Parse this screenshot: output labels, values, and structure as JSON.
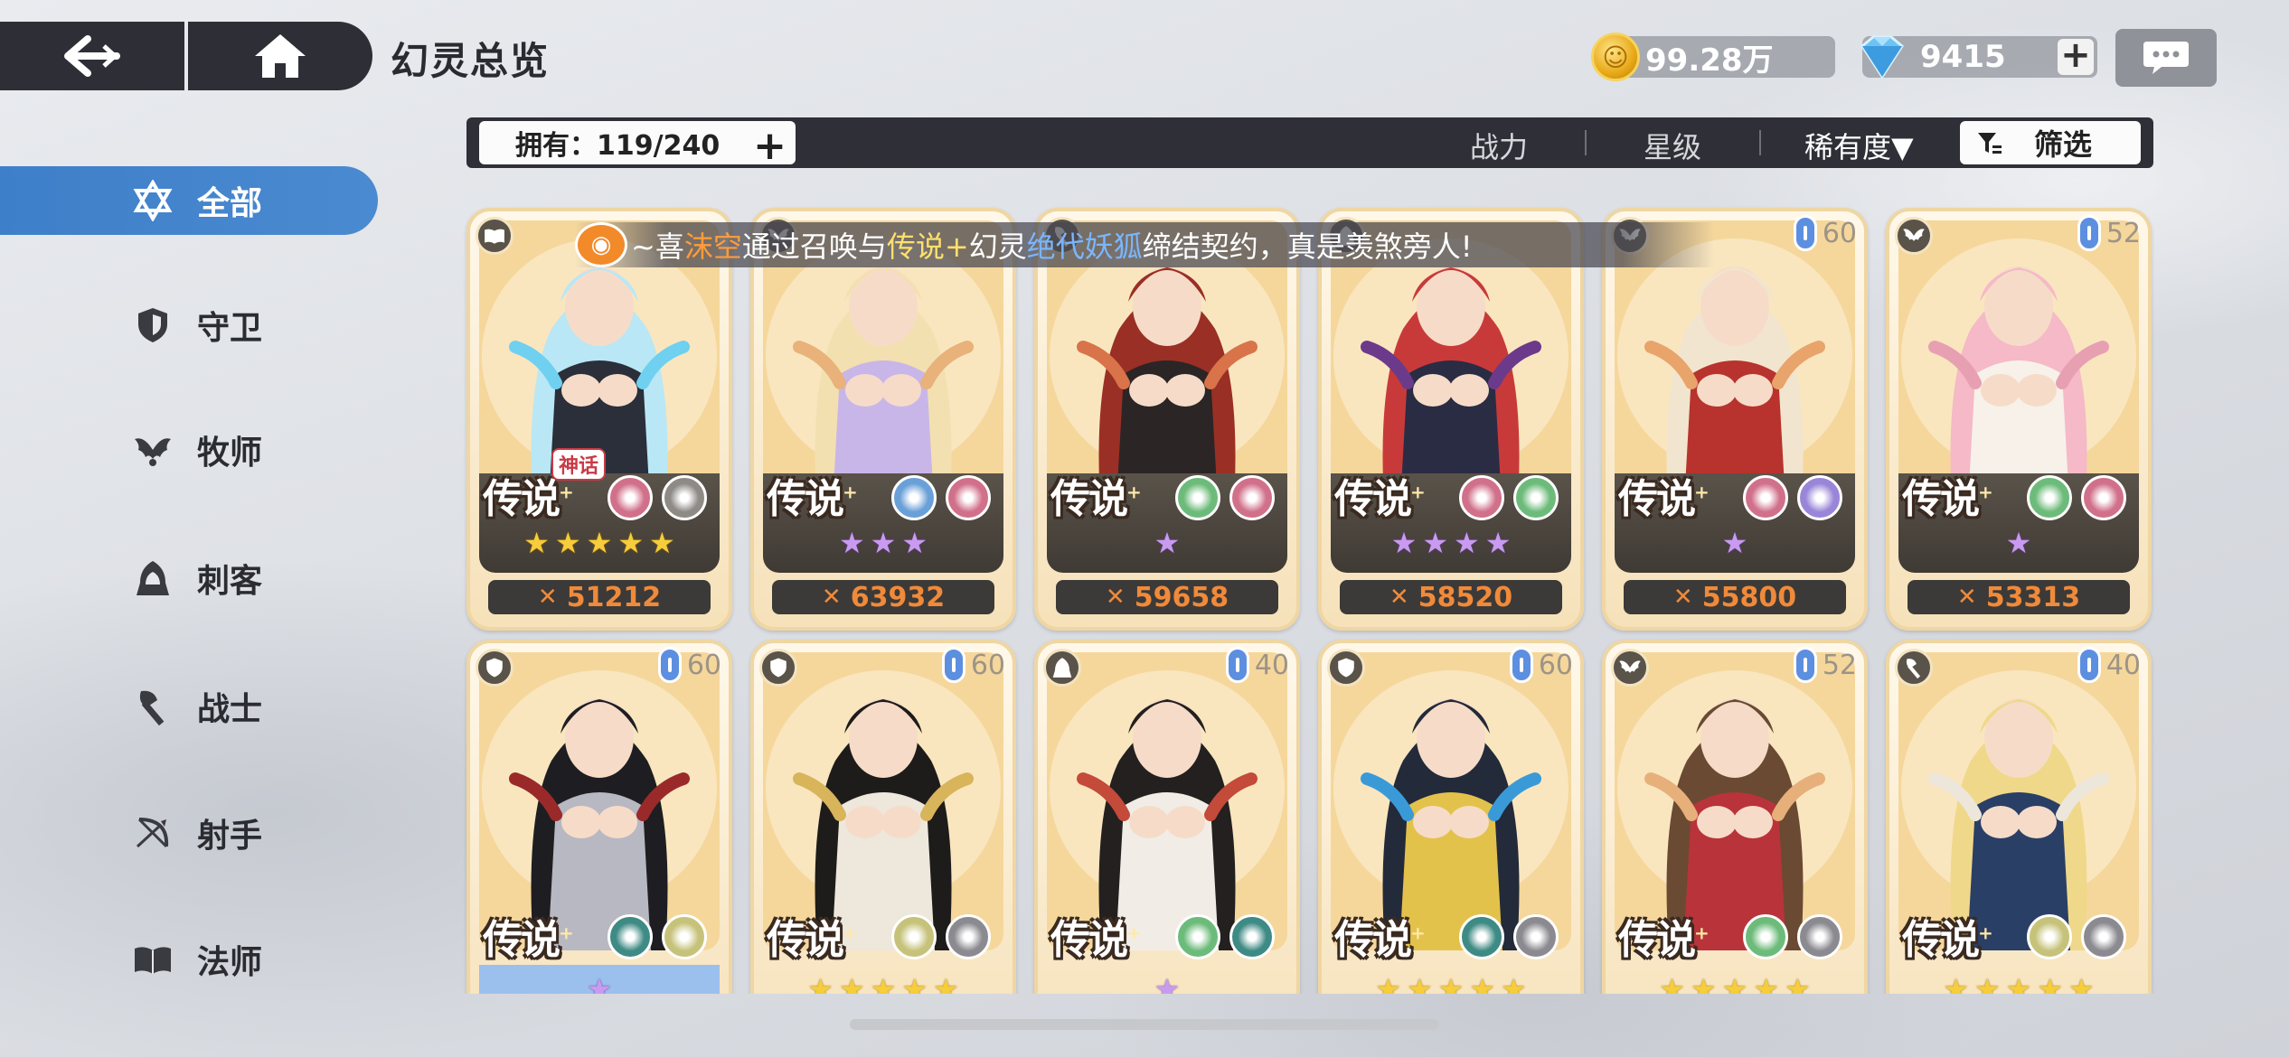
{
  "header": {
    "title": "幻灵总览",
    "gold": "99.28万",
    "gems": "9415",
    "plus_symbol": "+"
  },
  "filter": {
    "owned": "拥有：119/240",
    "plus_symbol": "+",
    "sort_power": "战力",
    "sort_star": "星级",
    "sort_rarity": "稀有度▼",
    "screen_label": "筛选"
  },
  "sidebar": {
    "items": [
      {
        "label": "全部",
        "icon": "star-of-david-icon"
      },
      {
        "label": "守卫",
        "icon": "shield-icon"
      },
      {
        "label": "牧师",
        "icon": "wings-icon"
      },
      {
        "label": "刺客",
        "icon": "hood-icon"
      },
      {
        "label": "战士",
        "icon": "axe-icon"
      },
      {
        "label": "射手",
        "icon": "bow-icon"
      },
      {
        "label": "法师",
        "icon": "book-icon"
      }
    ]
  },
  "marquee": {
    "part1": "~喜",
    "name": "沫空",
    "part2": "通过召唤与",
    "rarity": "传说+",
    "part3": "幻灵",
    "spirit": "绝代妖狐",
    "part4": "缔结契约，真是羡煞旁人!"
  },
  "cards": [
    {
      "job": "book-icon",
      "level": "",
      "rarity": "传说",
      "myth": "神话",
      "elements": [
        "#d1708a",
        "#8e8a86"
      ],
      "stars": 5,
      "star_color": "gold",
      "power": "51212",
      "palette": [
        "#b9e7f5",
        "#2a2f3a",
        "#6fd0ef"
      ]
    },
    {
      "job": "wings-icon",
      "level": "",
      "rarity": "传说",
      "myth": "",
      "elements": [
        "#6aa0d8",
        "#d1708a"
      ],
      "stars": 3,
      "star_color": "purple",
      "power": "63932",
      "palette": [
        "#f3e0b0",
        "#c9b6e8",
        "#e8b27a"
      ]
    },
    {
      "job": "axe-icon",
      "level": "",
      "rarity": "传说",
      "myth": "",
      "elements": [
        "#6dbb7a",
        "#d1708a"
      ],
      "stars": 1,
      "star_color": "purple",
      "power": "59658",
      "palette": [
        "#9a2f25",
        "#2b2526",
        "#d8734a"
      ]
    },
    {
      "job": "hood-icon",
      "level": "",
      "rarity": "传说",
      "myth": "",
      "elements": [
        "#d1708a",
        "#6dbb7a"
      ],
      "stars": 4,
      "star_color": "purple",
      "power": "58520",
      "palette": [
        "#c83a3a",
        "#2a2c44",
        "#6c3a8a"
      ]
    },
    {
      "job": "wings-icon",
      "level": "60",
      "rarity": "传说",
      "myth": "",
      "elements": [
        "#d1708a",
        "#9a86d8"
      ],
      "stars": 1,
      "star_color": "purple",
      "power": "55800",
      "palette": [
        "#f2e5cf",
        "#b8332d",
        "#e8a46a"
      ]
    },
    {
      "job": "wings-icon",
      "level": "52",
      "rarity": "传说",
      "myth": "",
      "elements": [
        "#6dbb7a",
        "#d1708a"
      ],
      "stars": 1,
      "star_color": "purple",
      "power": "53313",
      "palette": [
        "#f5b9c7",
        "#f7f1ea",
        "#e7a0b2"
      ]
    },
    {
      "job": "shield-icon",
      "level": "60",
      "rarity": "传说",
      "myth": "",
      "elements": [
        "#3e8a84",
        "#c6c27a"
      ],
      "stars": 1,
      "star_color": "purple",
      "power": "",
      "palette": [
        "#1e1e22",
        "#b8b8c2",
        "#9a2a2a"
      ]
    },
    {
      "job": "shield-icon",
      "level": "60",
      "rarity": "传说",
      "myth": "",
      "elements": [
        "#c6c27a",
        "#8a8a90"
      ],
      "stars": 5,
      "star_color": "gold",
      "power": "",
      "palette": [
        "#1e1c1a",
        "#ede7dc",
        "#d8b45a"
      ]
    },
    {
      "job": "hood-icon",
      "level": "40",
      "rarity": "传说",
      "myth": "",
      "elements": [
        "#6dbb7a",
        "#3e8a84"
      ],
      "stars": 1,
      "star_color": "purple",
      "power": "",
      "palette": [
        "#23201f",
        "#f1ede6",
        "#c44a3a"
      ]
    },
    {
      "job": "shield-icon",
      "level": "60",
      "rarity": "传说",
      "myth": "",
      "elements": [
        "#3e8a84",
        "#8a8a90"
      ],
      "stars": 5,
      "star_color": "gold",
      "power": "",
      "palette": [
        "#232a3a",
        "#e3c24c",
        "#3a9ad8"
      ]
    },
    {
      "job": "wings-icon",
      "level": "52",
      "rarity": "传说",
      "myth": "",
      "elements": [
        "#6dbb7a",
        "#8a8a90"
      ],
      "stars": 5,
      "star_color": "gold",
      "power": "",
      "palette": [
        "#6a4a32",
        "#b8343a",
        "#e7b07a"
      ]
    },
    {
      "job": "axe-icon",
      "level": "40",
      "rarity": "传说",
      "myth": "",
      "elements": [
        "#c6c27a",
        "#8a8a90"
      ],
      "stars": 5,
      "star_color": "gold",
      "power": "",
      "palette": [
        "#f0d88a",
        "#2a3f66",
        "#ede6da"
      ]
    }
  ]
}
